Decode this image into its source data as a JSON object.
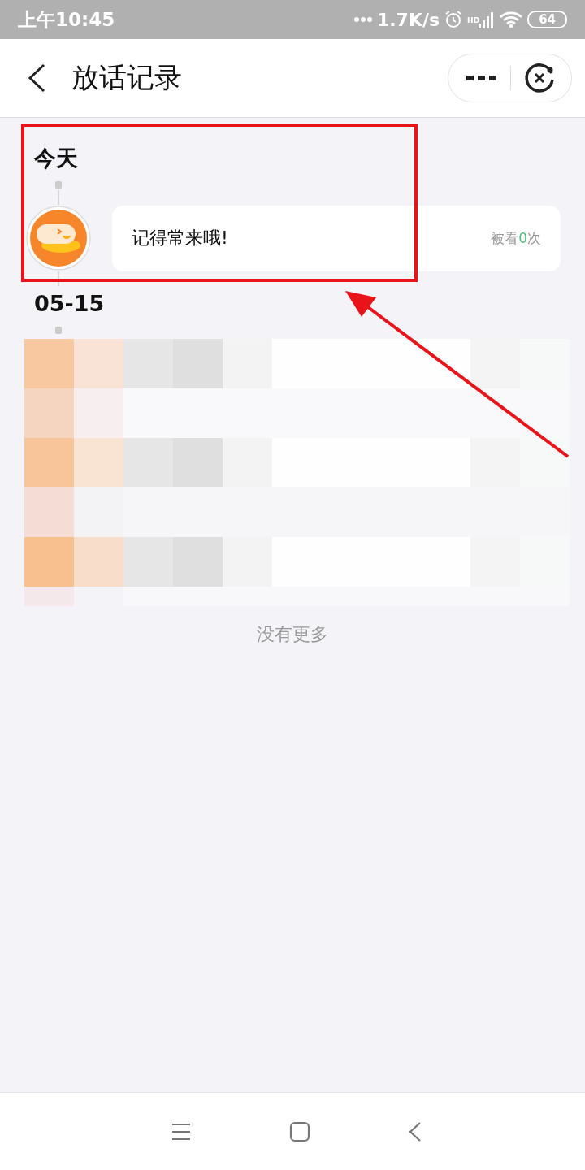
{
  "status_bar": {
    "time": "上午10:45",
    "network_speed": "1.7K/s",
    "signal_label": "HD",
    "battery": "64"
  },
  "header": {
    "title": "放话记录"
  },
  "timeline": [
    {
      "date": "今天",
      "entries": [
        {
          "message": "记得常来哦!",
          "views": {
            "prefix": "被看",
            "count": "0",
            "suffix": "次"
          }
        }
      ]
    },
    {
      "date": "05-15"
    }
  ],
  "footer_note": "没有更多"
}
